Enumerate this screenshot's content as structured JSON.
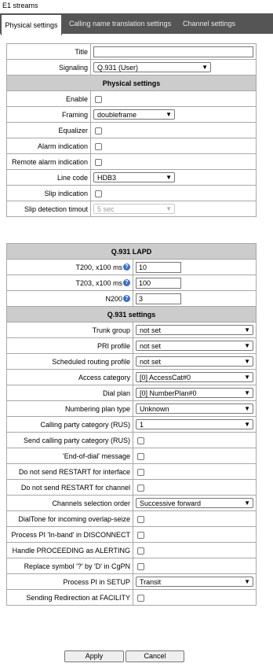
{
  "window": {
    "title": "E1 streams"
  },
  "tabs": [
    {
      "label": "Physical settings",
      "active": true
    },
    {
      "label": "Calling name translation settings",
      "active": false
    },
    {
      "label": "Channel settings",
      "active": false
    }
  ],
  "physical": {
    "title_label": "Title",
    "title_value": "",
    "signaling_label": "Signaling",
    "signaling_value": "Q.931 (User)",
    "section_header": "Physical settings",
    "enable_label": "Enable",
    "framing_label": "Framing",
    "framing_value": "doubleframe",
    "equalizer_label": "Equalizer",
    "alarm_label": "Alarm indication",
    "remote_alarm_label": "Remote alarm indication",
    "line_code_label": "Line code",
    "line_code_value": "HDB3",
    "slip_label": "Slip indication",
    "slip_timeout_label": "Slip detection timout",
    "slip_timeout_value": "5 sec"
  },
  "lapd": {
    "header": "Q.931 LAPD",
    "t200_label": "T200, x100 ms",
    "t200_value": "10",
    "t203_label": "T203, x100 ms",
    "t203_value": "100",
    "n200_label": "N200",
    "n200_value": "3"
  },
  "q931": {
    "header": "Q.931 settings",
    "trunk_group_label": "Trunk group",
    "trunk_group_value": "not set",
    "pri_profile_label": "PRI profile",
    "pri_profile_value": "not set",
    "sched_routing_label": "Scheduled routing profile",
    "sched_routing_value": "not set",
    "access_category_label": "Access category",
    "access_category_value": "[0] AccessCat#0",
    "dial_plan_label": "Dial plan",
    "dial_plan_value": "[0] NumberPlan#0",
    "numbering_plan_label": "Numbering plan type",
    "numbering_plan_value": "Unknown",
    "calling_party_cat_label": "Calling party category (RUS)",
    "calling_party_cat_value": "1",
    "send_cpc_label": "Send calling party category (RUS)",
    "end_of_dial_label": "'End-of-dial' message",
    "no_restart_interface_label": "Do not send RESTART for interface",
    "no_restart_channel_label": "Do not send RESTART for channel",
    "channel_selection_label": "Channels selection order",
    "channel_selection_value": "Successive forward",
    "dialtone_label": "DialTone for incoming overlap-seize",
    "process_pi_disconnect_label": "Process PI 'In-band' in DISCONNECT",
    "proceeding_alerting_label": "Handle PROCEEDING as ALERTING",
    "replace_symbol_label": "Replace symbol '?' by 'D' in CgPN",
    "process_pi_setup_label": "Process PI in SETUP",
    "process_pi_setup_value": "Transit",
    "redirection_label": "Sending Redirection at FACILITY"
  },
  "buttons": {
    "apply": "Apply",
    "cancel": "Cancel"
  },
  "icons": {
    "help": "help-icon",
    "dropdown": "chevron-down-icon"
  },
  "colors": {
    "tabbar": "#555555",
    "section_header": "#cccccc",
    "help_icon": "#3f6fc5"
  }
}
